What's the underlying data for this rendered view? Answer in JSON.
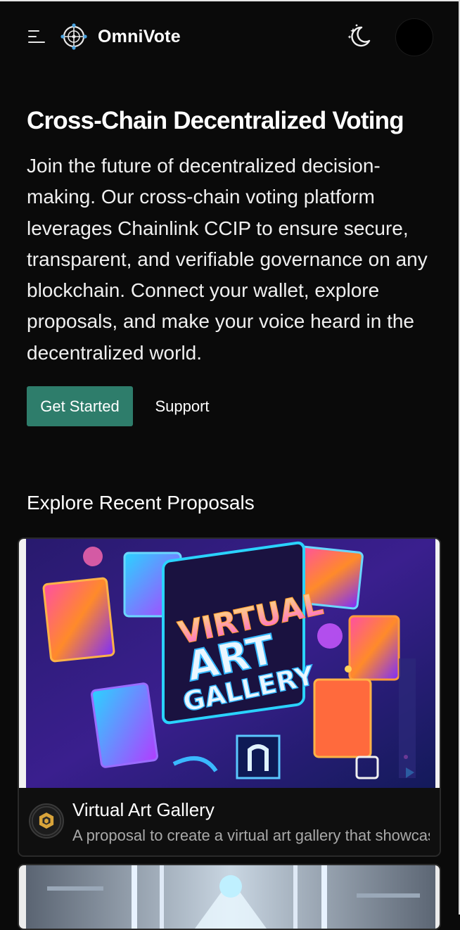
{
  "header": {
    "brand": "OmniVote"
  },
  "hero": {
    "title": "Cross-Chain Decentralized Voting",
    "description": "Join the future of decentralized decision-making. Our cross-chain voting platform leverages Chainlink CCIP to ensure secure, transparent, and verifiable governance on any blockchain. Connect your wallet, explore proposals, and make your voice heard in the decentralized world.",
    "primary_button": "Get Started",
    "secondary_button": "Support"
  },
  "proposals": {
    "section_title": "Explore Recent Proposals",
    "items": [
      {
        "title": "Virtual Art Gallery",
        "description": "A proposal to create a virtual art gallery that showcases",
        "image_text": [
          "VIRTUAL",
          "ART",
          "GALLERY"
        ]
      }
    ]
  },
  "colors": {
    "background": "#0a0a0a",
    "primary_button": "#2e7d6b",
    "text": "#ffffff",
    "muted_text": "#a9a9a9"
  },
  "icons": [
    "menu-icon",
    "omnivote-logo-icon",
    "theme-toggle-icon",
    "proposal-token-icon"
  ]
}
